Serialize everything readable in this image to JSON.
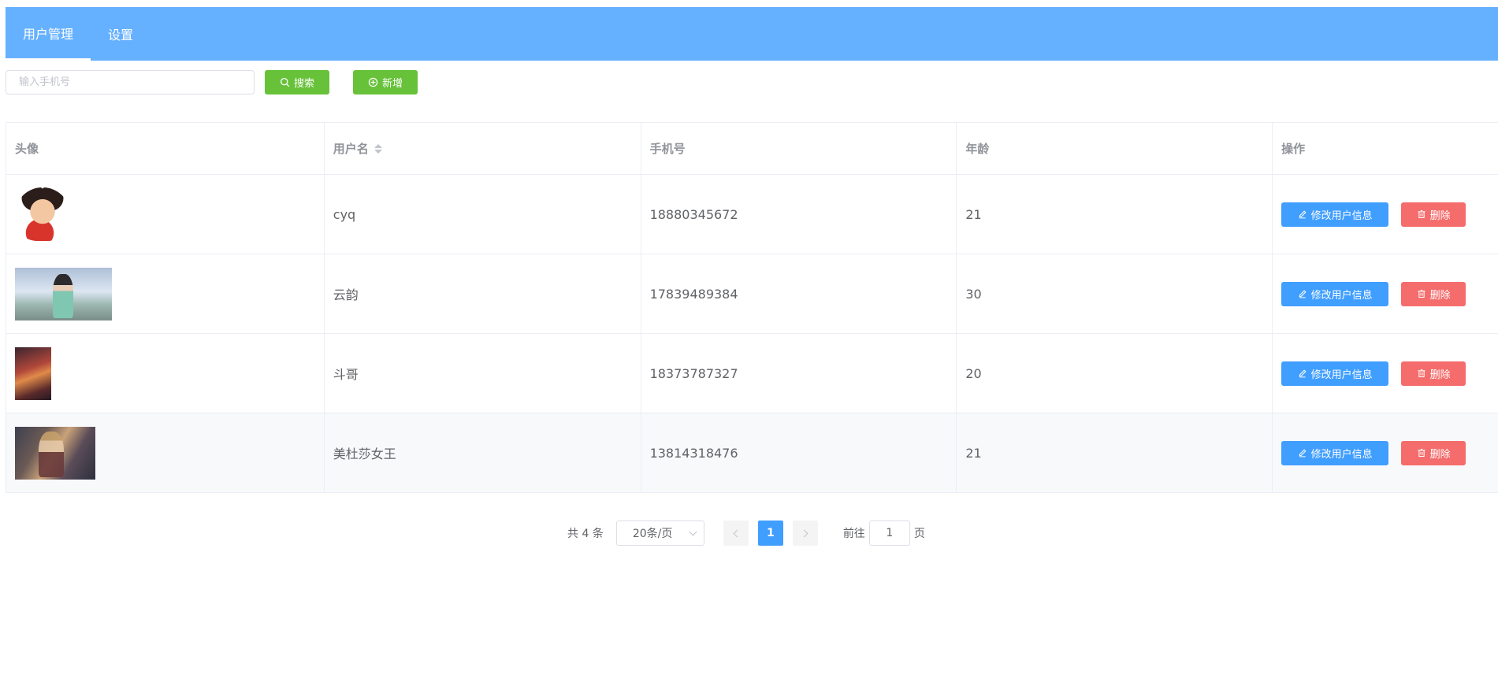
{
  "nav": {
    "tabs": [
      {
        "label": "用户管理",
        "active": true
      },
      {
        "label": "设置",
        "active": false
      }
    ]
  },
  "toolbar": {
    "search_placeholder": "输入手机号",
    "search_value": "",
    "search_label": "搜索",
    "add_label": "新增"
  },
  "table": {
    "columns": [
      "头像",
      "用户名",
      "手机号",
      "年龄",
      "操作"
    ],
    "rows": [
      {
        "username": "cyq",
        "phone": "18880345672",
        "age": "21"
      },
      {
        "username": "云韵",
        "phone": "17839489384",
        "age": "30"
      },
      {
        "username": "斗哥",
        "phone": "18373787327",
        "age": "20"
      },
      {
        "username": "美杜莎女王",
        "phone": "13814318476",
        "age": "21"
      }
    ],
    "edit_label": "修改用户信息",
    "delete_label": "删除"
  },
  "pagination": {
    "total_text": "共 4 条",
    "page_size": "20条/页",
    "current_page": "1",
    "jump_prefix": "前往",
    "jump_value": "1",
    "jump_suffix": "页"
  },
  "colors": {
    "header": "#66b1ff",
    "primary": "#409eff",
    "success": "#67c23a",
    "danger": "#f56c6c"
  },
  "icons": {
    "search": "search-icon",
    "add": "circle-plus-icon",
    "edit": "edit-icon",
    "delete": "trash-icon",
    "sort": "sort-caret-icon"
  }
}
